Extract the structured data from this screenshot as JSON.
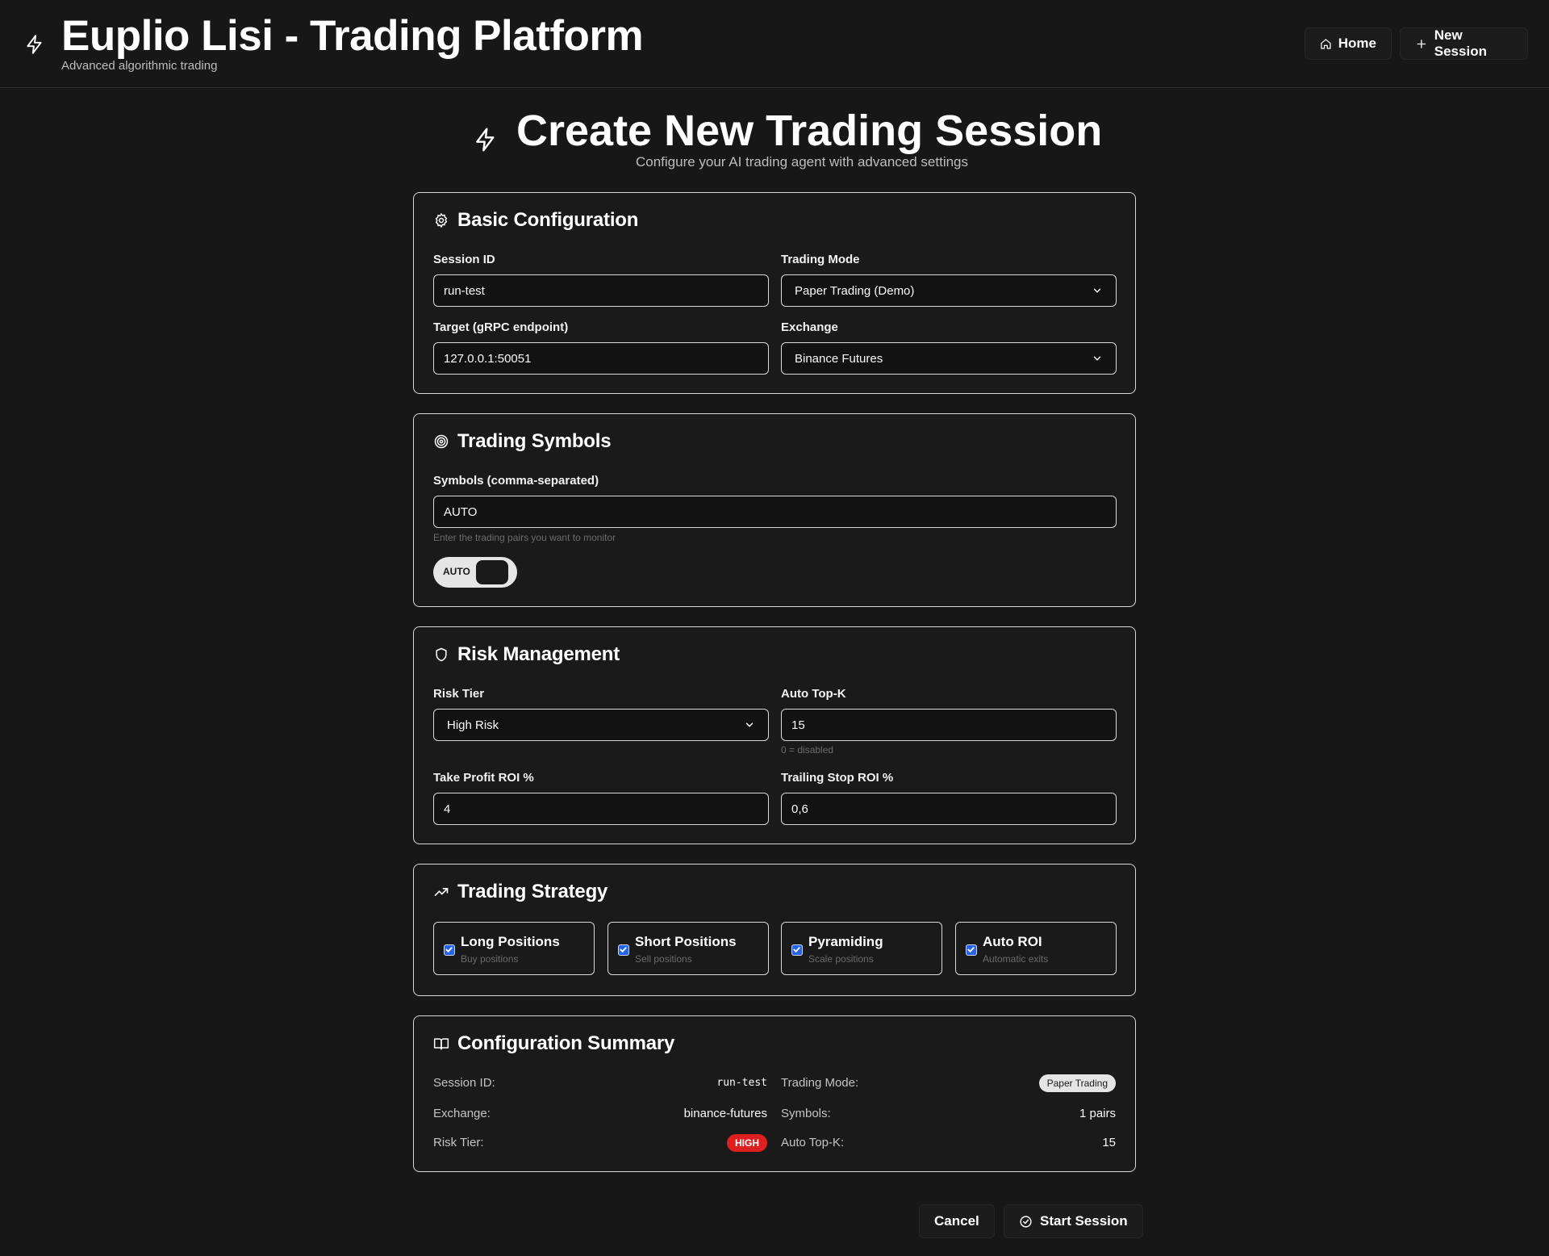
{
  "header": {
    "title": "Euplio Lisi - Trading Platform",
    "subtitle": "Advanced algorithmic trading",
    "nav": {
      "home_label": "Home",
      "new_session_label": "New Session"
    }
  },
  "page": {
    "title": "Create New Trading Session",
    "subtitle": "Configure your AI trading agent with advanced settings"
  },
  "basic": {
    "title": "Basic Configuration",
    "session_id_label": "Session ID",
    "session_id_value": "run-test",
    "trading_mode_label": "Trading Mode",
    "trading_mode_value": "Paper Trading (Demo)",
    "target_label": "Target (gRPC endpoint)",
    "target_value": "127.0.0.1:50051",
    "exchange_label": "Exchange",
    "exchange_value": "Binance Futures"
  },
  "symbols": {
    "title": "Trading Symbols",
    "label": "Symbols (comma-separated)",
    "value": "AUTO",
    "hint": "Enter the trading pairs you want to monitor",
    "toggle_label": "AUTO"
  },
  "risk": {
    "title": "Risk Management",
    "tier_label": "Risk Tier",
    "tier_value": "High Risk",
    "topk_label": "Auto Top-K",
    "topk_value": "15",
    "topk_hint": "0 = disabled",
    "tp_label": "Take Profit ROI %",
    "tp_value": "4",
    "ts_label": "Trailing Stop ROI %",
    "ts_value": "0,6"
  },
  "strategy": {
    "title": "Trading Strategy",
    "options": [
      {
        "title": "Long Positions",
        "sub": "Buy positions",
        "checked": true
      },
      {
        "title": "Short Positions",
        "sub": "Sell positions",
        "checked": true
      },
      {
        "title": "Pyramiding",
        "sub": "Scale positions",
        "checked": true
      },
      {
        "title": "Auto ROI",
        "sub": "Automatic exits",
        "checked": true
      }
    ]
  },
  "summary": {
    "title": "Configuration Summary",
    "session_id_label": "Session ID:",
    "session_id_value": "run-test",
    "trading_mode_label": "Trading Mode:",
    "trading_mode_value": "Paper Trading",
    "exchange_label": "Exchange:",
    "exchange_value": "binance-futures",
    "symbols_label": "Symbols:",
    "symbols_value": "1 pairs",
    "risk_tier_label": "Risk Tier:",
    "risk_tier_value": "HIGH",
    "topk_label": "Auto Top-K:",
    "topk_value": "15"
  },
  "actions": {
    "cancel_label": "Cancel",
    "start_label": "Start Session"
  },
  "colors": {
    "background": "#171717",
    "accent_checkbox": "#2563eb",
    "badge_high": "#dc1f1f",
    "border": "#d9d9d9"
  }
}
